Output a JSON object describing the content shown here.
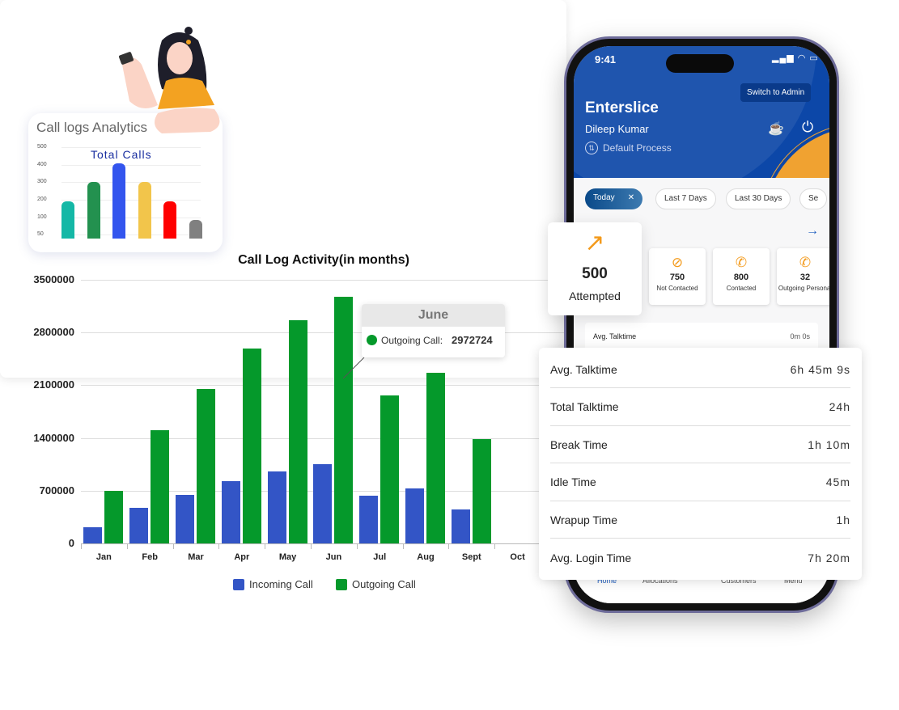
{
  "small_card": {
    "title": "Call logs Analytics",
    "chart_title": "Total Calls",
    "chart_data": {
      "type": "bar",
      "title": "Total Calls",
      "yticks": [
        "500",
        "400",
        "300",
        "200",
        "100",
        "50"
      ],
      "values": [
        200,
        300,
        400,
        300,
        200,
        100
      ],
      "colors": [
        "#14b8a6",
        "#23914f",
        "#3355ee",
        "#f2c54b",
        "#ff0000",
        "#808080"
      ]
    }
  },
  "main_chart": {
    "chart_data": {
      "type": "bar",
      "title": "Call Log Activity(in months)",
      "categories": [
        "Jan",
        "Feb",
        "Mar",
        "Apr",
        "May",
        "Jun",
        "Jul",
        "Aug",
        "Sept",
        "Oct"
      ],
      "yticks": [
        "3500000",
        "2800000",
        "2100000",
        "1400000",
        "700000",
        "0"
      ],
      "ylim": [
        0,
        3500000
      ],
      "grid": true,
      "legend": "bottom",
      "series": [
        {
          "name": "Incoming Call",
          "color": "#3355c6",
          "values": [
            215000,
            470000,
            645000,
            825000,
            955000,
            1050000,
            635000,
            730000,
            450000,
            null
          ]
        },
        {
          "name": "Outgoing Call",
          "color": "#05992b",
          "values": [
            700000,
            1500000,
            2050000,
            2590000,
            2960000,
            3270000,
            1970000,
            2260000,
            1390000,
            null
          ]
        }
      ]
    },
    "tooltip": {
      "title": "June",
      "label": "Outgoing Call:",
      "value": "2972724"
    }
  },
  "phone": {
    "time": "9:41",
    "switch_label": "Switch to Admin",
    "company": "Enterslice",
    "user": "Dileep Kumar",
    "process": "Default Process",
    "filters": [
      "Today",
      "Last 7 Days",
      "Last 30 Days",
      "Se"
    ],
    "attempted": {
      "value": "500",
      "label": "Attempted"
    },
    "stats": [
      {
        "value": "750",
        "label": "Not Contacted",
        "icon": "⊘"
      },
      {
        "value": "800",
        "label": "Contacted",
        "icon": "✆"
      },
      {
        "value": "32",
        "label": "Outgoing Personal",
        "icon": "✆"
      }
    ],
    "avg_row": {
      "label": "Avg. Talktime",
      "value": "0m 0s"
    },
    "nav": [
      "Home",
      "Allocations",
      "Customers",
      "Menu"
    ],
    "accent": "#0c47a8",
    "orange": "#f0a231"
  },
  "talktime": [
    {
      "label": "Avg. Talktime",
      "value": "6h 45m 9s"
    },
    {
      "label": "Total Talktime",
      "value": "24h"
    },
    {
      "label": "Break Time",
      "value": "1h 10m"
    },
    {
      "label": "Idle Time",
      "value": "45m"
    },
    {
      "label": "Wrapup Time",
      "value": "1h"
    },
    {
      "label": "Avg. Login Time",
      "value": "7h 20m"
    }
  ]
}
